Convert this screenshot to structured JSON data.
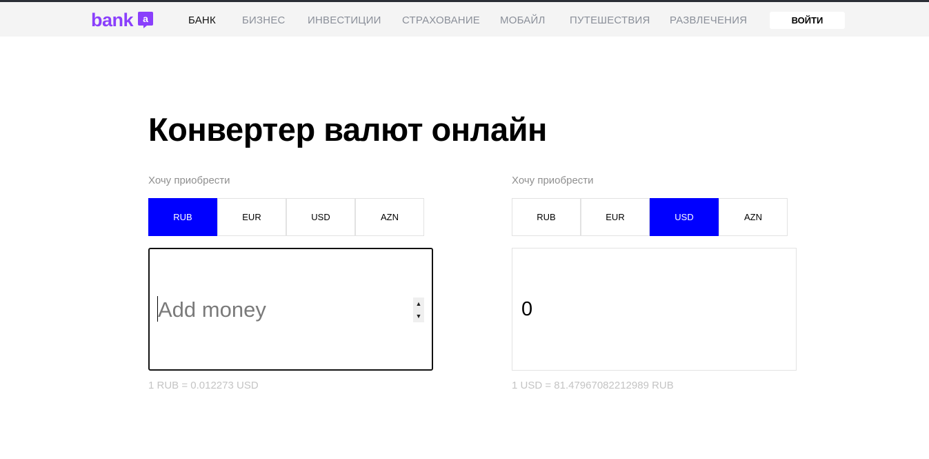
{
  "header": {
    "logo_text": "bank",
    "logo_badge": "a",
    "nav": [
      "БАНК",
      "БИЗНЕС",
      "ИНВЕСТИЦИИ",
      "СТРАХОВАНИЕ",
      "МОБАЙЛ",
      "ПУТЕШЕСТВИЯ",
      "РАЗВЛЕЧЕНИЯ"
    ],
    "active_nav": "БАНК",
    "login_label": "ВОЙТИ"
  },
  "main": {
    "title": "Конвертер валют онлайн",
    "left": {
      "label": "Хочу приобрести",
      "currencies": [
        "RUB",
        "EUR",
        "USD",
        "AZN"
      ],
      "selected": "RUB",
      "input_placeholder": "Add money",
      "input_value": "",
      "rate": "1 RUB = 0.012273 USD"
    },
    "right": {
      "label": "Хочу приобрести",
      "currencies": [
        "RUB",
        "EUR",
        "USD",
        "AZN"
      ],
      "selected": "USD",
      "output_value": "0",
      "rate": "1 USD = 81.47967082212989 RUB"
    }
  },
  "colors": {
    "brand": "#8a3ffc",
    "selected_currency": "#0000ff",
    "header_bg": "#f4f4f4"
  }
}
